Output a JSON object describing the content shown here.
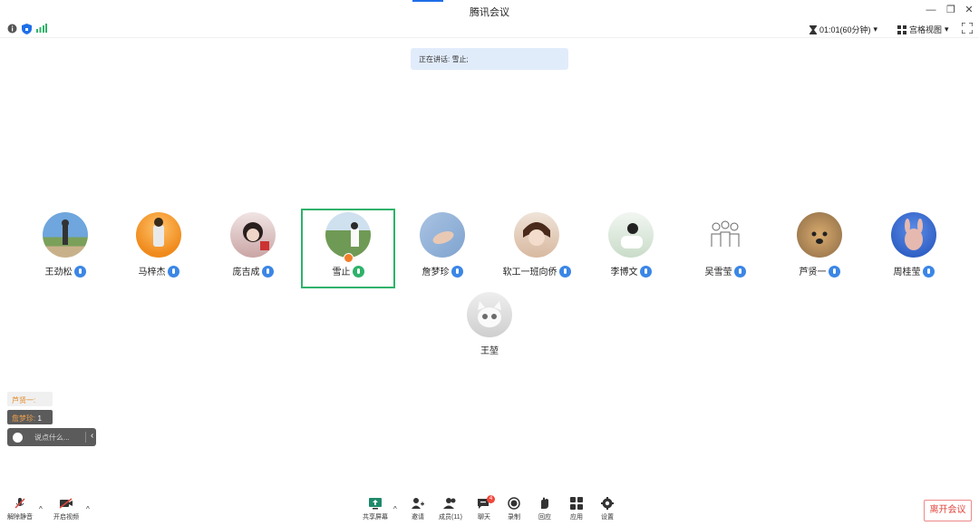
{
  "window": {
    "title": "腾讯会议"
  },
  "status": {
    "timer": "01:01(60分钟)",
    "view_mode": "宫格视图"
  },
  "speaking": {
    "text": "正在讲话: 雪止;"
  },
  "participants": [
    {
      "name": "王劲松",
      "mic": "blue"
    },
    {
      "name": "马梓杰",
      "mic": "blue"
    },
    {
      "name": "庞吉成",
      "mic": "blue"
    },
    {
      "name": "雪止",
      "mic": "green",
      "active": true,
      "host": true
    },
    {
      "name": "詹梦珍",
      "mic": "blue"
    },
    {
      "name": "软工一班向侨",
      "mic": "blue"
    },
    {
      "name": "李博文",
      "mic": "blue"
    },
    {
      "name": "吴雪莹",
      "mic": "blue"
    },
    {
      "name": "芦贤一",
      "mic": "blue"
    },
    {
      "name": "周桂莹",
      "mic": "blue"
    },
    {
      "name": "王堃",
      "mic": "none"
    }
  ],
  "chat": {
    "msg1_sender": "芦贤一:",
    "msg2_sender": "詹梦珍:",
    "msg2_text": "1",
    "input_placeholder": "说点什么...",
    "collapse": "‹"
  },
  "toolbar": {
    "unmute": "解除静音",
    "start_video": "开启视频",
    "share_screen": "共享屏幕",
    "invite": "邀请",
    "members": "成员(11)",
    "chat": "聊天",
    "chat_badge": "4",
    "record": "录制",
    "react": "回应",
    "apps": "应用",
    "settings": "设置",
    "leave": "离开会议"
  },
  "colors": {
    "accent": "#1e6fe8",
    "active_border": "#2fb26a",
    "leave_red": "#e2453c",
    "banner_bg": "#e1ecfb"
  }
}
